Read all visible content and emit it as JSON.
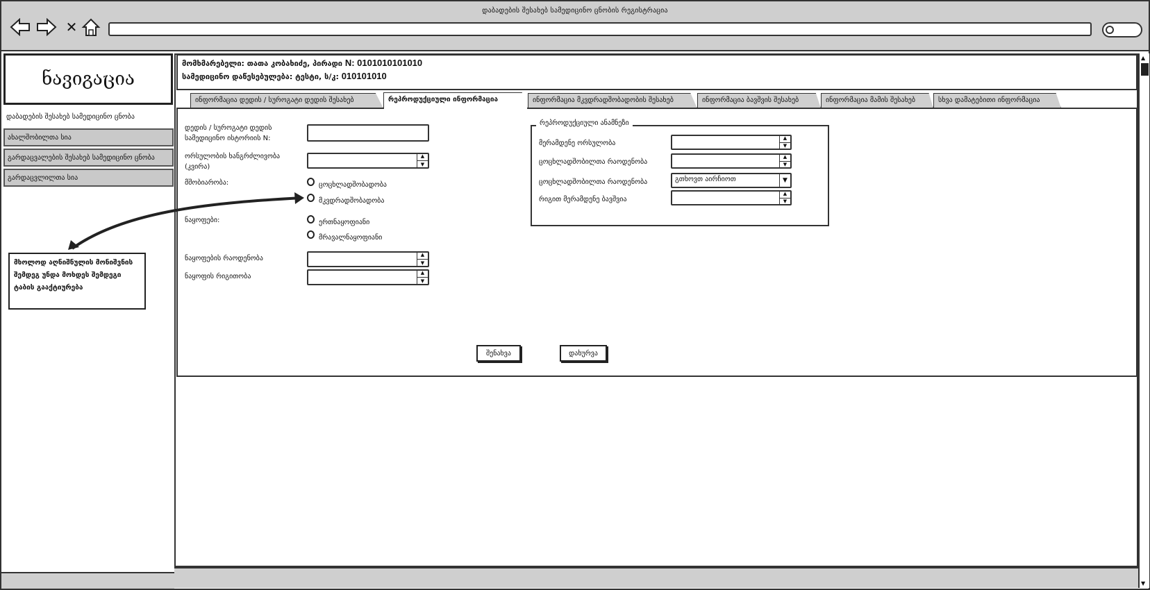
{
  "window": {
    "title": "დაბადების შესახებ სამედიცინო ცნობის რეგისტრაცია"
  },
  "browser": {
    "back": "back-arrow",
    "forward": "forward-arrow",
    "close": "✕",
    "home": "home-icon",
    "address": ""
  },
  "sidebar": {
    "heading": "ნავიგაცია",
    "items": [
      {
        "label": "დაბადების შესახებ სამედიცინო ცნობა"
      },
      {
        "label": "ახალშობილთა სია"
      },
      {
        "label": "გარდაცვალების შესახებ სამედიცინო ცნობა"
      },
      {
        "label": "გარდაცვლილთა სია"
      }
    ],
    "note": "მხოლოდ აღნიშნულის მონიშვნის შემდეგ უნდა მოხდეს შემდეგი ტაბის გააქტიურება"
  },
  "user": {
    "line1_label": "მომხმარებელი: თათა კობახიძე, პირადი ",
    "line1_value": "N: 0101010101010",
    "line2_label": "სამედიცინო დაწესებულება: ტესტი, ს/კ: ",
    "line2_value": "010101010"
  },
  "tabs": [
    {
      "label": "ინფორმაცია დედის / სუროგატი დედის შესახებ"
    },
    {
      "label": "რეპროდუქციული ინფორმაცია"
    },
    {
      "label": "ინფორმაცია მკვდრადშობადობის შესახებ"
    },
    {
      "label": "ინფორმაცია ბავშვის შესახებ"
    },
    {
      "label": "ინფორმაცია მამის შესახებ"
    },
    {
      "label": "სხვა დამატებითი ინფორმაცია"
    }
  ],
  "form": {
    "history_label": "დედის / სუროგატი დედის სამედიცინო ისტორიის N:",
    "history_value": "",
    "pregnancy_label": "ორსულობის ხანგრძლივობა (კვირა)",
    "pregnancy_value": "",
    "birth_label": "მშობიარობა:",
    "birth_options": [
      "ცოცხლადშობადობა",
      "მკვდრადშობადობა"
    ],
    "fetus_label": "ნაყოფები:",
    "fetus_options": [
      "ერთნაყოფიანი",
      "მრავალნაყოფიანი"
    ],
    "fetus_count_label": "ნაყოფების რაოდენობა",
    "fetus_count_value": "",
    "fetus_order_label": "ნაყოფის რიგითობა",
    "fetus_order_value": ""
  },
  "anamnesis": {
    "legend": "რეპროდუქციული ანამნეზი",
    "rows": [
      {
        "label": "მერამდენე ორსულობა",
        "value": ""
      },
      {
        "label": "ცოცხლადშობილთა რაოდენობა",
        "value": ""
      },
      {
        "label": "ცოცხლადშობილთა რაოდენობა",
        "value": "გთხოვთ აირჩიოთ"
      },
      {
        "label": "რიგით მერამდენე ბავშვია",
        "value": ""
      }
    ]
  },
  "buttons": {
    "save": "შენახვა",
    "close": "დახურვა"
  }
}
